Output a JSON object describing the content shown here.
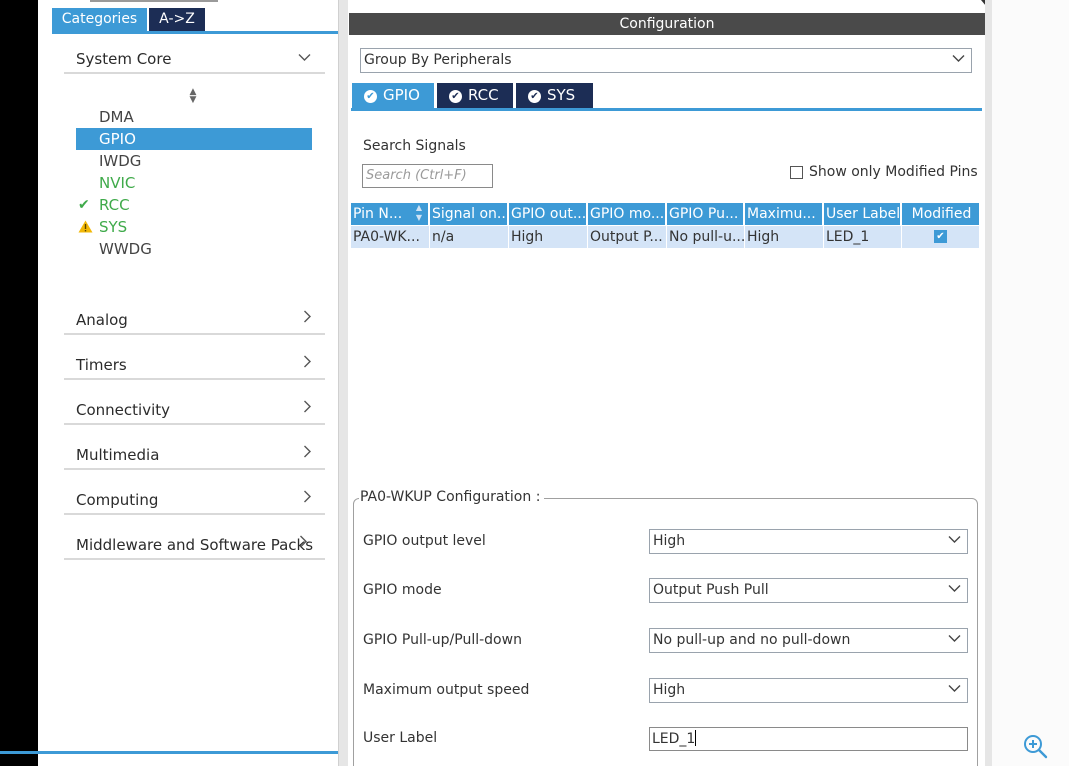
{
  "categories": {
    "tabs": [
      {
        "label": "Categories"
      },
      {
        "label": "A->Z"
      }
    ],
    "system_core": {
      "label": "System Core",
      "items": [
        {
          "label": "DMA",
          "status": ""
        },
        {
          "label": "GPIO",
          "status": "selected"
        },
        {
          "label": "IWDG",
          "status": ""
        },
        {
          "label": "NVIC",
          "status": "enabled"
        },
        {
          "label": "RCC",
          "status": "check"
        },
        {
          "label": "SYS",
          "status": "warning"
        },
        {
          "label": "WWDG",
          "status": ""
        }
      ]
    },
    "sections": [
      {
        "label": "Analog"
      },
      {
        "label": "Timers"
      },
      {
        "label": "Connectivity"
      },
      {
        "label": "Multimedia"
      },
      {
        "label": "Computing"
      },
      {
        "label": "Middleware and Software Packs"
      }
    ]
  },
  "configuration": {
    "title": "Configuration",
    "group_by": "Group By Peripherals",
    "tabs": [
      {
        "label": "GPIO"
      },
      {
        "label": "RCC"
      },
      {
        "label": "SYS"
      }
    ],
    "search_label": "Search Signals",
    "search_placeholder": "Search (Ctrl+F)",
    "show_modified_label": "Show only Modified Pins",
    "show_modified_checked": false,
    "columns": [
      "Pin N...",
      "Signal on...",
      "GPIO out...",
      "GPIO mo...",
      "GPIO Pu...",
      "Maximu...",
      "User Label",
      "Modified"
    ],
    "rows": [
      {
        "pin": "PA0-WK...",
        "signal": "n/a",
        "output": "High",
        "mode": "Output P...",
        "pull": "No pull-u...",
        "speed": "High",
        "user_label": "LED_1",
        "modified": true
      }
    ],
    "pin_config": {
      "title": "PA0-WKUP Configuration :",
      "fields": [
        {
          "label": "GPIO output level",
          "value": "High"
        },
        {
          "label": "GPIO mode",
          "value": "Output Push Pull"
        },
        {
          "label": "GPIO Pull-up/Pull-down",
          "value": "No pull-up and no pull-down"
        },
        {
          "label": "Maximum output speed",
          "value": "High"
        },
        {
          "label": "User Label",
          "value": "LED_1"
        }
      ]
    }
  },
  "colors": {
    "accent": "#3d9ad6",
    "navy": "#1c2d55",
    "header": "#4a4a4a",
    "green": "#3faa4a",
    "warning": "#f2b807"
  }
}
